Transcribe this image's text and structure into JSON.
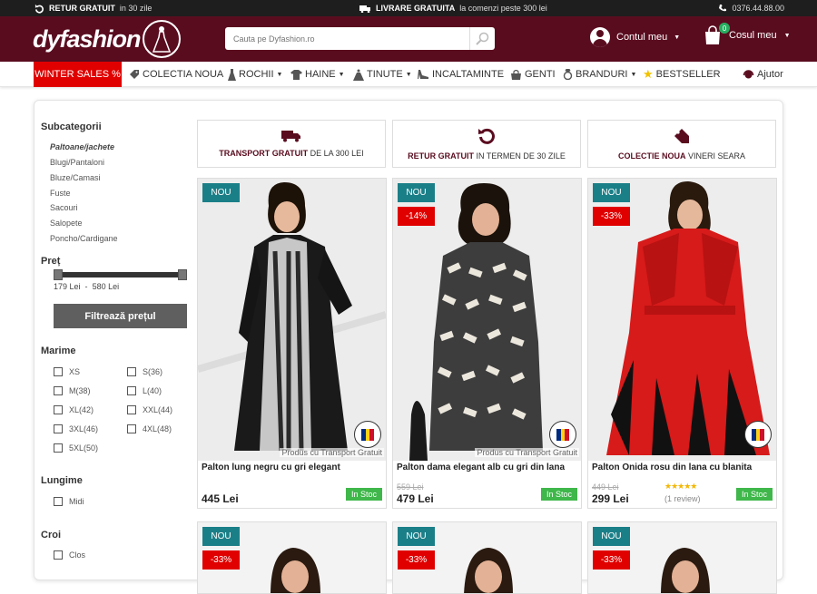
{
  "topbar": {
    "return_bold": "RETUR GRATUIT",
    "return_rest": "in 30 zile",
    "delivery_bold": "LIVRARE GRATUITA",
    "delivery_rest": "la comenzi peste 300 lei",
    "phone": "0376.44.88.00"
  },
  "header": {
    "logo": "dyfashion",
    "search_placeholder": "Cauta pe Dyfashion.ro",
    "account": "Contul meu",
    "cart": "Cosul meu",
    "cart_count": "0"
  },
  "nav": {
    "winter": "WINTER SALES %",
    "items": [
      "COLECTIA NOUA",
      "ROCHII",
      "HAINE",
      "TINUTE",
      "INCALTAMINTE",
      "GENTI",
      "BRANDURI",
      "BESTSELLER"
    ],
    "help": "Ajutor"
  },
  "sidebar": {
    "subcategories_title": "Subcategorii",
    "subcategories": [
      "Paltoane/jachete",
      "Blugi/Pantaloni",
      "Bluze/Camasi",
      "Fuste",
      "Sacouri",
      "Salopete",
      "Poncho/Cardigane"
    ],
    "price_title": "Preț",
    "price_min": "179 Lei",
    "price_sep": "-",
    "price_max": "580 Lei",
    "filter_button": "Filtrează prețul",
    "size_title": "Marime",
    "sizes_left": [
      "XS",
      "M(38)",
      "XL(42)",
      "3XL(46)",
      "5XL(50)"
    ],
    "sizes_right": [
      "S(36)",
      "L(40)",
      "XXL(44)",
      "4XL(48)"
    ],
    "length_title": "Lungime",
    "lengths": [
      "Midi"
    ],
    "cut_title": "Croi",
    "cuts": [
      "Clos"
    ]
  },
  "promos": [
    {
      "bold": "TRANSPORT GRATUIT",
      "rest": "DE LA 300 LEI"
    },
    {
      "bold": "RETUR GRATUIT",
      "rest": "IN TERMEN DE 30 ZILE"
    },
    {
      "bold": "COLECTIE NOUA",
      "rest": "VINERI SEARA"
    }
  ],
  "products": [
    {
      "new": "NOU",
      "discount": "",
      "name": "Palton lung negru cu gri elegant",
      "old_price": "",
      "price": "445 Lei",
      "stock": "In Stoc",
      "transport": "Produs cu Transport Gratuit",
      "stars": "",
      "reviews": "",
      "colors": {
        "main": "#1a1a1a",
        "accent": "#cfcfcf"
      }
    },
    {
      "new": "NOU",
      "discount": "-14%",
      "name": "Palton dama elegant alb cu gri din lana",
      "old_price": "559 Lei",
      "price": "479 Lei",
      "stock": "In Stoc",
      "transport": "Produs cu Transport Gratuit",
      "stars": "",
      "reviews": "",
      "colors": {
        "main": "#444444",
        "accent": "#e9e5dc"
      }
    },
    {
      "new": "NOU",
      "discount": "-33%",
      "name": "Palton Onida rosu din lana cu blanita",
      "old_price": "449 Lei",
      "price": "299 Lei",
      "stock": "In Stoc",
      "transport": "",
      "stars": "★★★★★",
      "reviews": "(1 review)",
      "colors": {
        "main": "#d51818",
        "accent": "#111111"
      }
    }
  ],
  "row2": [
    {
      "new": "NOU",
      "discount": "-33%"
    },
    {
      "new": "NOU",
      "discount": "-33%"
    },
    {
      "new": "NOU",
      "discount": "-33%"
    }
  ],
  "made_in": "FABRICAT IN ROMANIA",
  "colors": {
    "brand": "#5a0c1f",
    "sale": "#e00000",
    "teal": "#1b7f88",
    "stock": "#3fb74a"
  }
}
